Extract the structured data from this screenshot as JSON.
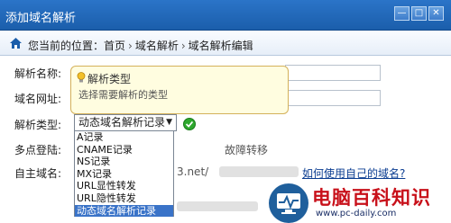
{
  "window": {
    "title": "添加域名解析",
    "buttons": {
      "minimize": "—",
      "maximize": "□",
      "close": "✕"
    }
  },
  "breadcrumb": {
    "prefix": "您当前的位置：",
    "items": [
      "首页",
      "域名解析",
      "域名解析编辑"
    ],
    "separator": "›"
  },
  "form": {
    "labels": {
      "resolve_name": "解析名称:",
      "domain_url": "域名网址:",
      "resolve_type": "解析类型:",
      "multi_login": "多点登陆:",
      "custom_domain": "自主域名:"
    },
    "resolve_type_selected": "动态域名解析记录",
    "multi_login_text": "故障转移",
    "custom_domain_text": "3.net/",
    "help_link": "如何使用自己的域名?"
  },
  "tooltip": {
    "title": "解析类型",
    "text": "选择需要解析的类型"
  },
  "dropdown": {
    "options": [
      "A记录",
      "CNAME记录",
      "NS记录",
      "MX记录",
      "URL显性转发",
      "URL隐性转发",
      "动态域名解析记录"
    ],
    "selected": "动态域名解析记录"
  },
  "watermark": {
    "title": "电脑百科知识",
    "url": "www.pc-daily.com"
  },
  "colors": {
    "titlebar": "#1b5eab",
    "accent": "#3a73c8",
    "success": "#2ea82e",
    "watermark_red": "#c8101a"
  }
}
